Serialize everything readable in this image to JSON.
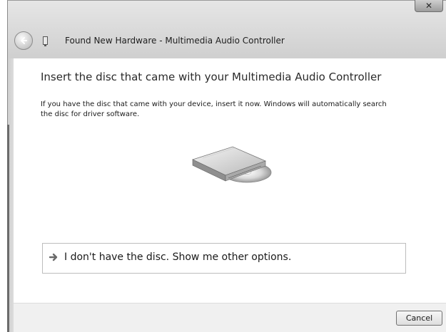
{
  "window": {
    "title": "Found New Hardware - Multimedia Audio Controller",
    "close_glyph": "✕"
  },
  "icons": {
    "back": "back-arrow-icon",
    "hardware": "hardware-device-icon",
    "disc": "disc-drive-icon",
    "option_arrow": "green-arrow-icon"
  },
  "main": {
    "heading": "Insert the disc that came with your Multimedia Audio Controller",
    "description": "If you have the disc that came with your device, insert it now.  Windows will automatically search the disc for driver software.",
    "option_label": "I don't have the disc.  Show me other options."
  },
  "footer": {
    "cancel_label": "Cancel"
  },
  "colors": {
    "frame": "#cfcfcf",
    "content_bg": "#ffffff",
    "footer_bg": "#f0f0f0"
  }
}
